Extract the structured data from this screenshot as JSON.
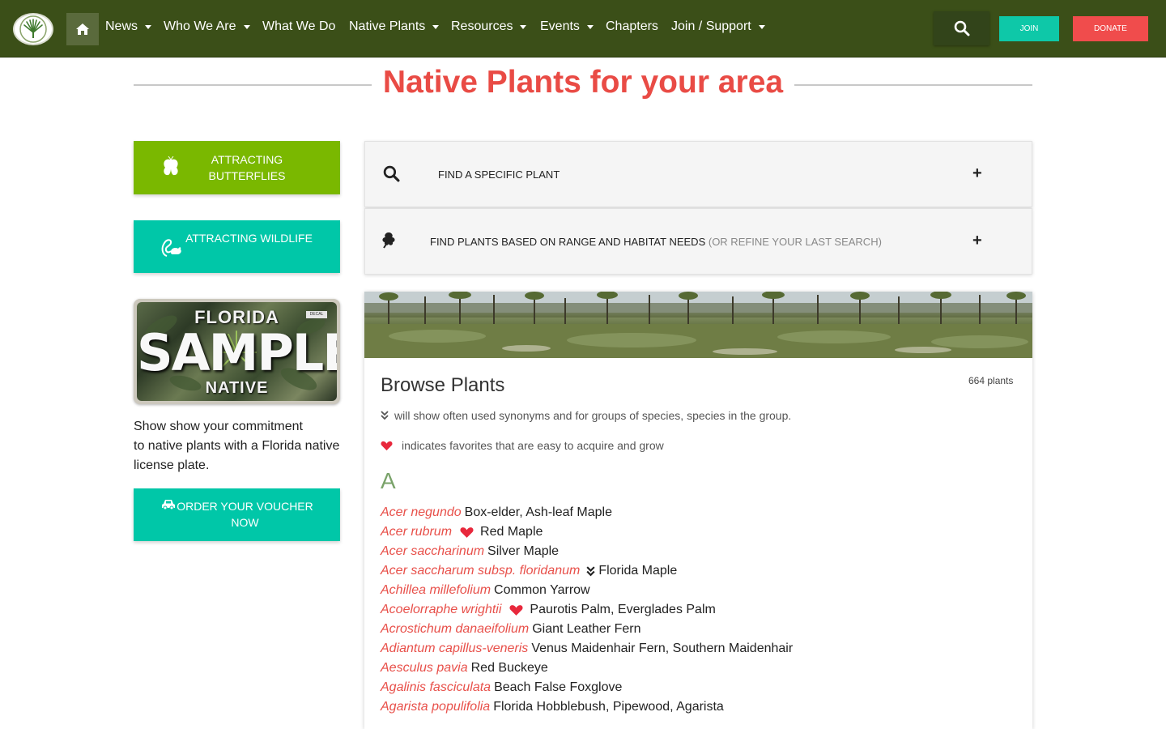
{
  "nav": {
    "items": [
      {
        "label": "News",
        "has_dropdown": true
      },
      {
        "label": "Who We Are",
        "has_dropdown": true
      },
      {
        "label": "What We Do",
        "has_dropdown": false
      },
      {
        "label": "Native Plants",
        "has_dropdown": true
      },
      {
        "label": "Resources",
        "has_dropdown": true
      },
      {
        "label": "Events",
        "has_dropdown": true
      },
      {
        "label": "Chapters",
        "has_dropdown": false
      },
      {
        "label": "Join / Support",
        "has_dropdown": true
      }
    ],
    "join_label": "JOIN",
    "donate_label": "DONATE"
  },
  "page_title": "Native Plants for your area",
  "sidebar": {
    "butterflies_line1": "ATTRACTING",
    "butterflies_line2": "BUTTERFLIES",
    "wildlife_label": "ATTRACTING WILDLIFE",
    "plate": {
      "state": "FLORIDA",
      "decal": "DECAL",
      "sample": "SAMPLE",
      "bottom": "NATIVE"
    },
    "promo_line1": "Show show your commitment",
    "promo_line2": "to native plants with a Florida native",
    "promo_line3": "license plate.",
    "order_line1": "ORDER YOUR VOUCHER",
    "order_line2": "NOW"
  },
  "accordion": {
    "specific_label": "FIND A SPECIFIC PLANT",
    "range_label": "FIND PLANTS BASED ON RANGE AND HABITAT NEEDS",
    "range_suffix": "(OR REFINE YOUR LAST SEARCH)",
    "expand_symbol": "+"
  },
  "browse": {
    "title": "Browse Plants",
    "count": "664 plants",
    "synonyms_note": "will show often used synonyms and for groups of species, species in the group.",
    "favorites_note": "indicates favorites that are easy to acquire and grow",
    "letter": "A",
    "plants": [
      {
        "scientific": "Acer negundo",
        "common": "Box-elder, Ash-leaf Maple",
        "favorite": false,
        "synonyms": false
      },
      {
        "scientific": "Acer rubrum",
        "common": "Red Maple",
        "favorite": true,
        "synonyms": false
      },
      {
        "scientific": "Acer saccharinum",
        "common": "Silver Maple",
        "favorite": false,
        "synonyms": false
      },
      {
        "scientific": "Acer saccharum subsp. floridanum",
        "common": "Florida Maple",
        "favorite": false,
        "synonyms": true
      },
      {
        "scientific": "Achillea millefolium",
        "common": "Common Yarrow",
        "favorite": false,
        "synonyms": false
      },
      {
        "scientific": "Acoelorraphe wrightii",
        "common": "Paurotis Palm, Everglades Palm",
        "favorite": true,
        "synonyms": false
      },
      {
        "scientific": "Acrostichum danaeifolium",
        "common": "Giant Leather Fern",
        "favorite": false,
        "synonyms": false
      },
      {
        "scientific": "Adiantum capillus-veneris",
        "common": "Venus Maidenhair Fern, Southern Maidenhair",
        "favorite": false,
        "synonyms": false
      },
      {
        "scientific": "Aesculus pavia",
        "common": "Red Buckeye",
        "favorite": false,
        "synonyms": false
      },
      {
        "scientific": "Agalinis fasciculata",
        "common": "Beach False Foxglove",
        "favorite": false,
        "synonyms": false
      },
      {
        "scientific": "Agarista populifolia",
        "common": "Florida Hobblebush, Pipewood, Agarista",
        "favorite": false,
        "synonyms": false
      }
    ]
  },
  "colors": {
    "nav_bg": "#3b4f18",
    "title_red": "#e94b45",
    "teal": "#00c7a8",
    "lime": "#7ab800",
    "donate_red": "#f04c4c",
    "heart": "#e8283c",
    "letter_green": "#7aa36a"
  },
  "icons": [
    "home-icon",
    "search-icon",
    "butterfly-icon",
    "squirrel-icon",
    "car-icon",
    "leaf-icon",
    "heart-icon",
    "double-chevron-icon"
  ]
}
